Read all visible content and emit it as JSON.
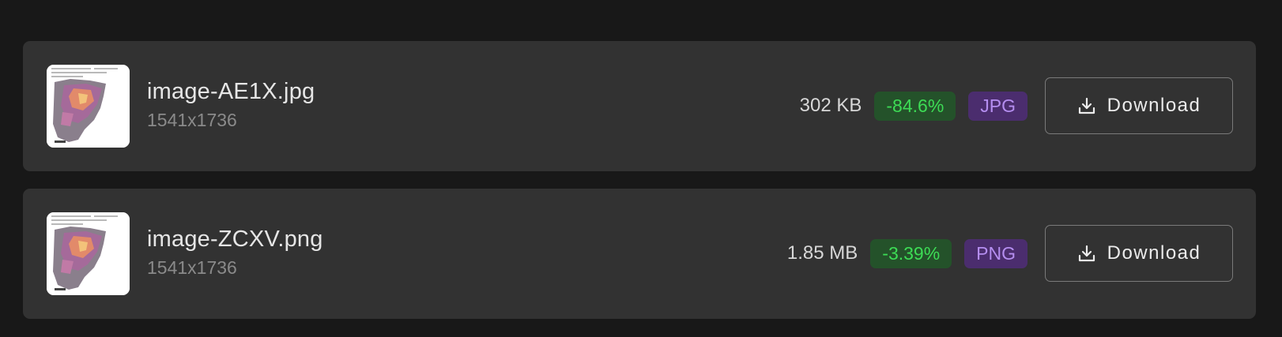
{
  "files": [
    {
      "name": "image-AE1X.jpg",
      "dimensions": "1541x1736",
      "size": "302 KB",
      "reduction": "-84.6%",
      "format": "JPG",
      "download_label": "Download"
    },
    {
      "name": "image-ZCXV.png",
      "dimensions": "1541x1736",
      "size": "1.85 MB",
      "reduction": "-3.39%",
      "format": "PNG",
      "download_label": "Download"
    }
  ],
  "icons": {
    "download": "download-icon",
    "thumbnail": "map-thumbnail"
  },
  "colors": {
    "background": "#181818",
    "card": "#323232",
    "reduction_bg": "#24522a",
    "reduction_text": "#3ddc55",
    "format_bg": "#4b2d6e",
    "format_text": "#b58ef0"
  }
}
